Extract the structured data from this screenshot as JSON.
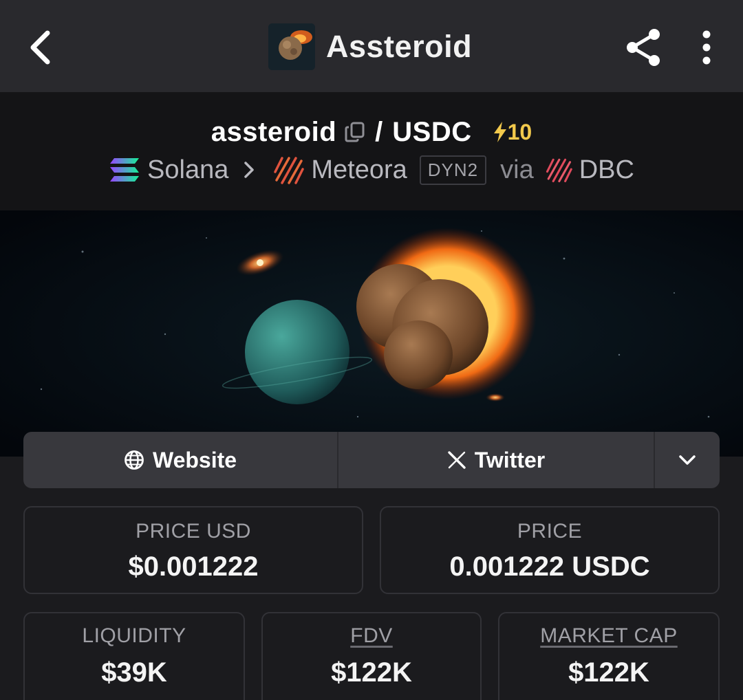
{
  "header": {
    "title": "Assteroid",
    "back_icon": "chevron-left-icon",
    "share_icon": "share-icon",
    "more_icon": "more-vertical-icon"
  },
  "pair": {
    "base": "assteroid",
    "separator": "/",
    "quote": "USDC",
    "boost": "10",
    "chain": "Solana",
    "dex": "Meteora",
    "dex_tag": "DYN2",
    "via": "via",
    "launchpad": "DBC"
  },
  "links": {
    "website": "Website",
    "twitter": "Twitter"
  },
  "stats": {
    "price_usd": {
      "label": "PRICE USD",
      "value": "$0.001222"
    },
    "price": {
      "label": "PRICE",
      "value": "0.001222 USDC"
    },
    "liquidity": {
      "label": "LIQUIDITY",
      "value": "$39K"
    },
    "fdv": {
      "label": "FDV",
      "value": "$122K"
    },
    "market_cap": {
      "label": "MARKET CAP",
      "value": "$122K"
    }
  },
  "colors": {
    "topbar_bg": "#29292d",
    "header_bg": "#141416",
    "page_bg": "#1b1b1e",
    "boost": "#f2c94c",
    "meteora": "#e0533e"
  }
}
